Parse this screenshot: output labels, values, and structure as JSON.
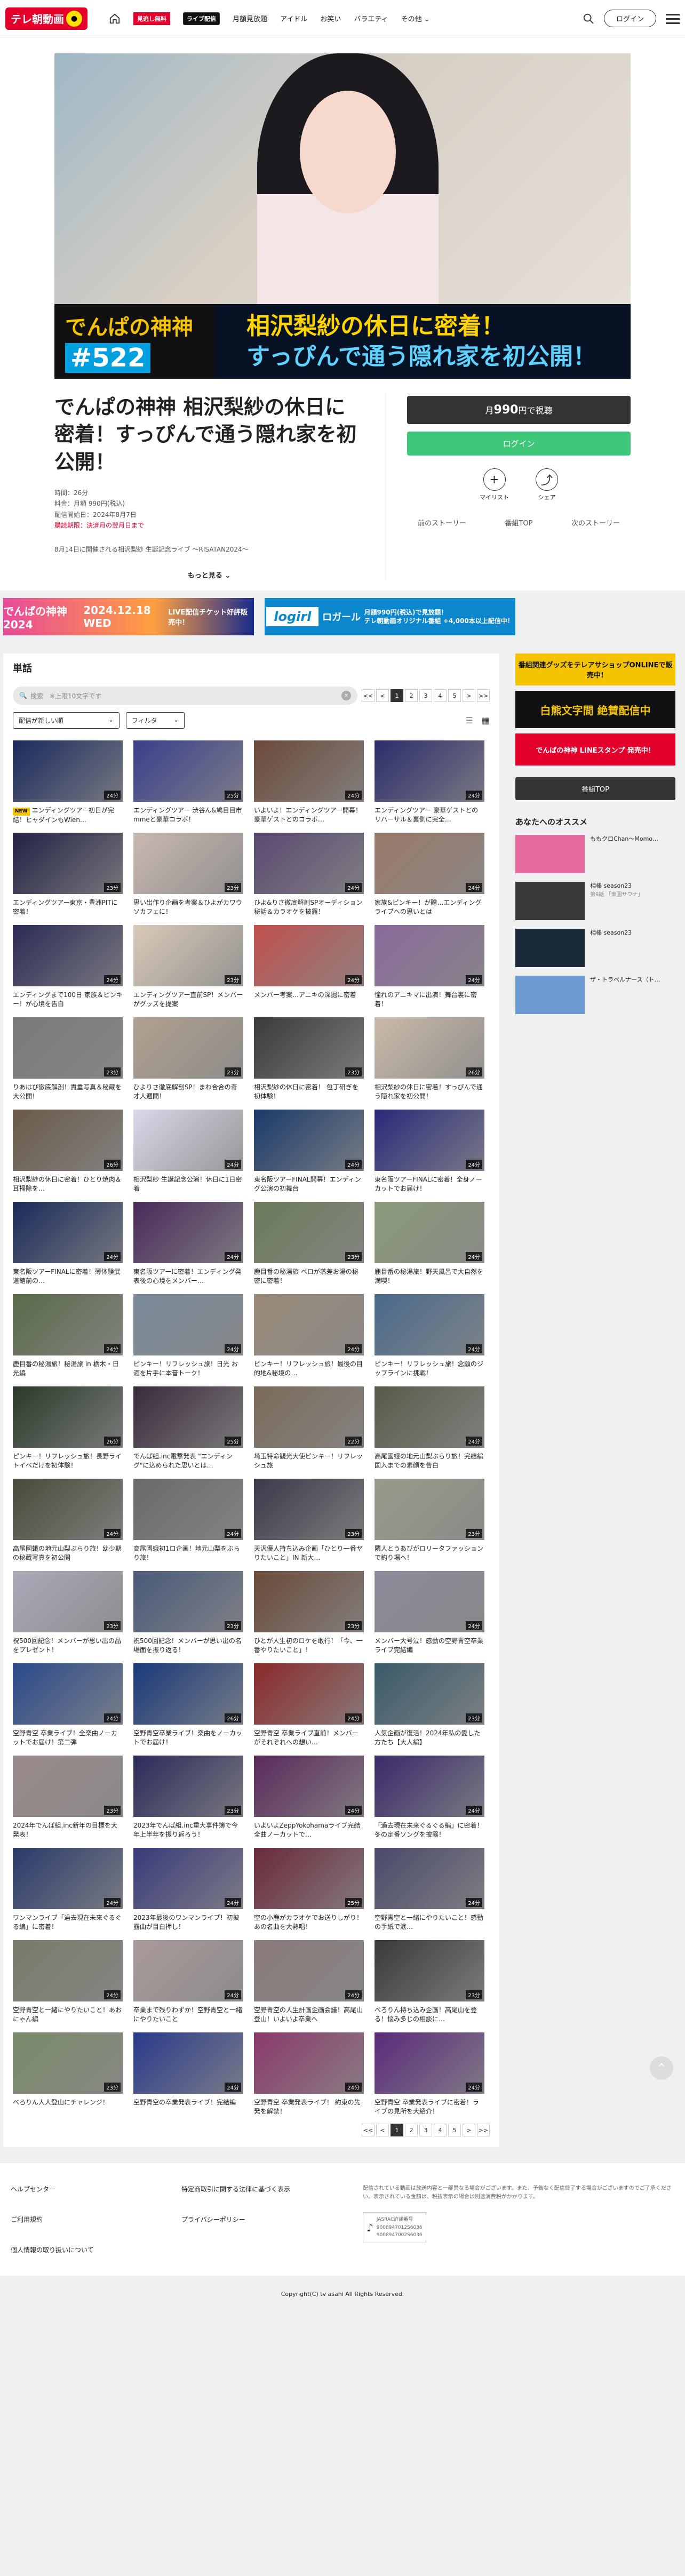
{
  "header": {
    "logo": "テレ朝動画",
    "nav": [
      "月額見放題",
      "アイドル",
      "お笑い",
      "バラエティ",
      "その他"
    ],
    "badge_premium": "見逃し無料",
    "badge_live": "ライブ配信",
    "login": "ログイン"
  },
  "hero": {
    "prog_name": "でんぱの神神",
    "prog_num": "#522",
    "title1": "相沢梨紗の休日に密着！",
    "title2": "すっぴんで通う隠れ家を初公開！"
  },
  "detail": {
    "title": "でんぱの神神 相沢梨紗の休日に密着！すっぴんで通う隠れ家を初公開！",
    "meta": [
      "時間：26分",
      "料金：月額 990円(税込)",
      "配信開始日：2024年8月7日"
    ],
    "warn": "購読期限：決済月の翌月日まで",
    "desc": "8月14日に開催される相沢梨紗 生誕記念ライブ ～RISATAN2024～",
    "more": "もっと見る"
  },
  "purchase": {
    "price_pre": "月",
    "price": "990",
    "price_post": "円で視聴",
    "login": "ログイン",
    "mylist": "マイリスト",
    "share": "シェア",
    "prev": "前のストーリー",
    "top": "番組TOP",
    "next": "次のストーリー"
  },
  "ads": {
    "ad1a": "でんぱの神神2024",
    "ad1b": "2024.12.18 WED",
    "ad1c": "LIVE配信チケット好評販売中！",
    "ad2logo": "logirl",
    "ad2a": "ロガール",
    "ad2b": "月額990円(税込)で見放題！",
    "ad2c": "テレ朝動画オリジナル番組 +4,000本以上配信中！"
  },
  "list": {
    "heading": "単話",
    "search_placeholder": "検索　※上限10文字です",
    "sort": "配信が新しい順",
    "filter": "フィルタ",
    "pages": [
      "<<",
      "<",
      "1",
      "2",
      "3",
      "4",
      "5",
      ">",
      ">>"
    ],
    "new_label": "NEW"
  },
  "episodes": [
    {
      "t": "エンディングツアー初日が完結！ヒャダインもWien…",
      "d": "24分",
      "c": "#1b2a5c",
      "new": true
    },
    {
      "t": "エンディングツアー 渋谷ん&鳩目目市mmeと豪華コラボ！",
      "d": "25分",
      "c": "#3a3f8a"
    },
    {
      "t": "いよいよ！エンディングツアー開幕！ 豪華ゲストとのコラボ…",
      "d": "24分",
      "c": "#6b4a3a"
    },
    {
      "t": "エンディングツアー 豪華ゲストとのリハーサル＆裏側に完全…",
      "d": "24分",
      "c": "#2c2c6a"
    },
    {
      "t": "エンディングツアー東京・豊洲PITに密着！",
      "d": "23分",
      "c": "#222244"
    },
    {
      "t": "思い出作り企画を考案＆ひよがカワウソカフェに！",
      "d": "23分",
      "c": "#c9b8b0"
    },
    {
      "t": "ひよ&りさ徹底解剖SPオーディション秘話＆カラオケを披露！",
      "d": "24分",
      "c": "#5a4a70"
    },
    {
      "t": "家族&ピンキー！が贈…エンディングライブへの思いとは",
      "d": "24分",
      "c": "#9a7a6a"
    },
    {
      "t": "エンディングまで100日 家族＆ピンキー！が心境を告白",
      "d": "24分",
      "c": "#2b2b55"
    },
    {
      "t": "エンディングツアー直前SP！メンバーがグッズを提案",
      "d": "23分",
      "c": "#d9c9b9"
    },
    {
      "t": "メンバー考案…アニキの深掘に密着",
      "d": "24分",
      "c": "#c0504d"
    },
    {
      "t": "憧れのアニキマに出演！舞台裏に密着！",
      "d": "24分",
      "c": "#8a6a9a"
    },
    {
      "t": "りあはぴ徹底解剖！貴重写真＆秘蔵を大公開！",
      "d": "23分",
      "c": "#7a7a7a"
    },
    {
      "t": "ひよりさ徹底解剖SP！まわ合合の奇才人週間！",
      "d": "23分",
      "c": "#b0a090"
    },
    {
      "t": "相沢梨紗の休日に密着！ 包丁研ぎを初体験！",
      "d": "23分",
      "c": "#3a3a3a"
    },
    {
      "t": "相沢梨紗の休日に密着！すっぴんで通う隠れ家を初公開！",
      "d": "26分",
      "c": "#c9b9a9"
    },
    {
      "t": "相沢梨紗の休日に密着！ひとり焼肉＆耳掃除を…",
      "d": "26分",
      "c": "#6a5a4a"
    },
    {
      "t": "相沢梨紗 生誕記念公演！休日に1日密着",
      "d": "24分",
      "c": "#d9d9e9"
    },
    {
      "t": "東名阪ツアーFINAL開幕！エンディング公演の初舞台",
      "d": "24分",
      "c": "#1a3a6a"
    },
    {
      "t": "東名阪ツアーFINALに密着！全身ノーカットでお届け！",
      "d": "24分",
      "c": "#2a2a7a"
    },
    {
      "t": "東名阪ツアーFINALに密着！薄体験武道館前の…",
      "d": "24分",
      "c": "#1a2a5a"
    },
    {
      "t": "東名阪ツアーに密着！エンディング発表後の心境をメンバー…",
      "d": "24分",
      "c": "#4a2a5a"
    },
    {
      "t": "鹿目番の秘湯旅 ベロが蒸差お湯の秘密に密着！",
      "d": "23分",
      "c": "#6a7a5a"
    },
    {
      "t": "鹿目番の秘湯旅！野天風呂で大自然を満喫！",
      "d": "24分",
      "c": "#8a9a7a"
    },
    {
      "t": "鹿目番の秘湯旅！秘湯旅 in 栃木・日光編",
      "d": "24分",
      "c": "#5a6a4a"
    },
    {
      "t": "ピンキー！リフレッシュ旅！日光 お酒を片手に本音トーク！",
      "d": "24分",
      "c": "#7a8a9a"
    },
    {
      "t": "ピンキー！リフレッシュ旅！最後の目的地&秘境の…",
      "d": "24分",
      "c": "#9a8a7a"
    },
    {
      "t": "ピンキー！リフレッシュ旅！念願のジップラインに挑戦！",
      "d": "24分",
      "c": "#4a6a8a"
    },
    {
      "t": "ピンキー！リフレッシュ旅！長野ライトイベだけを初体験！",
      "d": "26分",
      "c": "#2a3a2a"
    },
    {
      "t": "でんぱ組.inc電撃発表 \"エンディング\"に込められた思いとは…",
      "d": "25分",
      "c": "#3a2a3a"
    },
    {
      "t": "埼玉特命観光大使ピンキー！リフレッシュ旅",
      "d": "22分",
      "c": "#7a6a5a"
    },
    {
      "t": "高尾國蛾の地元山梨ぶらり旅！完結編 国入までの素顔を告白",
      "d": "24分",
      "c": "#5a5a4a"
    },
    {
      "t": "高尾國蛾の地元山梨ぶらり旅！幼少期の秘蔵写真を初公開",
      "d": "24分",
      "c": "#4a4a3a"
    },
    {
      "t": "高尾國蛾初1ロ企画！地元山梨をぶらり旅！",
      "d": "24分",
      "c": "#6a6a6a"
    },
    {
      "t": "天沢優人持ち込み企画「ひとり一番ヤりたいこと」IN 新大…",
      "d": "23分",
      "c": "#3a3a4a"
    },
    {
      "t": "隣人とうあびがロリータファッションで釣り場へ！",
      "d": "23分",
      "c": "#9a9a8a"
    },
    {
      "t": "祝500回記念！メンバーが思い出の品をプレゼント！",
      "d": "23分",
      "c": "#a9a9b9"
    },
    {
      "t": "祝500回記念！メンバーが思い出の名場面を振り返る！",
      "d": "23分",
      "c": "#4a5a7a"
    },
    {
      "t": "ひとが人生初のロケを敢行！「今、一番やりたいこと」！",
      "d": "23分",
      "c": "#6a4a3a"
    },
    {
      "t": "メンバー大号泣！感動の空野青空卒業ライブ完結編",
      "d": "24分",
      "c": "#8a8a9a"
    },
    {
      "t": "空野青空 卒業ライブ！全楽曲ノーカットでお届け！第二弾",
      "d": "24分",
      "c": "#2a4a8a"
    },
    {
      "t": "空野青空卒業ライブ！楽曲をノーカットでお届け！",
      "d": "26分",
      "c": "#1a3a7a"
    },
    {
      "t": "空野青空 卒業ライブ直前！メンバーがそれぞれへの想い…",
      "d": "24分",
      "c": "#8a2a2a"
    },
    {
      "t": "人気企画が復活！2024年私の愛した方たち【大人編】",
      "d": "23分",
      "c": "#3a5a6a"
    },
    {
      "t": "2024年でんぱ組.inc新年の目標を大発表！",
      "d": "23分",
      "c": "#9a8a8a"
    },
    {
      "t": "2023年でんぱ組.inc重大事件簿で今年上半年を振り返ろう！",
      "d": "23分",
      "c": "#2a2a5a"
    },
    {
      "t": "いよいよZeppYokohamaライブ完結 全曲ノーカットで…",
      "d": "24分",
      "c": "#5a2a5a"
    },
    {
      "t": "「過去現在未来ぐるぐる編」に密着！冬の定番ソングを披露！",
      "d": "24分",
      "c": "#3a2a6a"
    },
    {
      "t": "ワンマンライブ「過去現在未来ぐるぐる編」に密着！",
      "d": "24分",
      "c": "#2a3a6a"
    },
    {
      "t": "2023年最後のワンマンライブ！初披露曲が目白押し！",
      "d": "24分",
      "c": "#3a3a7a"
    },
    {
      "t": "空の小鹿がカラオケでお送りしがり！あの名曲を大熱唱！",
      "d": "25分",
      "c": "#6a2a3a"
    },
    {
      "t": "空野青空と一緒にやりたいこと！感動の手紙で涙…",
      "d": "24分",
      "c": "#4a4a6a"
    },
    {
      "t": "空野青空と一緒にやりたいこと！あおにゃん編",
      "d": "24分",
      "c": "#7a7a6a"
    },
    {
      "t": "卒業まで残りわずか！空野青空と一緒にやりたいこと",
      "d": "24分",
      "c": "#aa9a9a"
    },
    {
      "t": "空野青空の人生計画企画会議！高尾山登山！いよいよ卒業へ",
      "d": "24分",
      "c": "#8a7a7a"
    },
    {
      "t": "べろりん持ち込み企画！高尾山を登る！悩み多じの相談に…",
      "d": "23分",
      "c": "#3a3a3a"
    },
    {
      "t": "べろりん人人登山にチャレンジ！",
      "d": "23分",
      "c": "#7a8a6a"
    },
    {
      "t": "空野青空の卒業発表ライブ！完結編",
      "d": "24分",
      "c": "#2a3a8a"
    },
    {
      "t": "空野青空 卒業発表ライブ！ 約東の先発を解禁！",
      "d": "24分",
      "c": "#8a3a6a"
    },
    {
      "t": "空野青空 卒業発表ライブに密着！ライブの見所を大紹介！",
      "d": "24分",
      "c": "#5a2a7a"
    }
  ],
  "side": {
    "b1": "番組関連グッズをテレアサショップONLINEで販売中!",
    "b2": "白熊文字間 絶賛配信中",
    "b3": "でんぱの神神 LINEスタンプ 発売中！",
    "top_btn": "番組TOP",
    "rec_heading": "あなたへのオススメ",
    "recs": [
      {
        "t": "ももクロChan～Momo…",
        "s": "",
        "c": "#e46aa0"
      },
      {
        "t": "相棒 season23",
        "s": "第9話 「楽園サウナ」",
        "c": "#3a3a3a"
      },
      {
        "t": "相棒 season23",
        "s": "",
        "c": "#1a2a3a"
      },
      {
        "t": "ザ・トラベルナース（ト…",
        "s": "",
        "c": "#6a9ad0"
      }
    ]
  },
  "footer": {
    "links": [
      "ヘルプセンター",
      "特定商取引に関する法律に基づく表示",
      "ご利用規約",
      "プライバシーポリシー",
      "個人情報の取り扱いについて"
    ],
    "info": "配信されている動画は放送内容と一部異なる場合がございます。また、予告なく配信終了する場合がございますのでご了承ください。表示されている金額は、税抜表示の場合は別途消費税がかかります。",
    "label": "JASRAC許諾番号",
    "jasrac1": "9008947012S6036",
    "jasrac2": "9008947002S6036",
    "copy": "Copyright(C) tv asahi All Rights Reserved."
  }
}
